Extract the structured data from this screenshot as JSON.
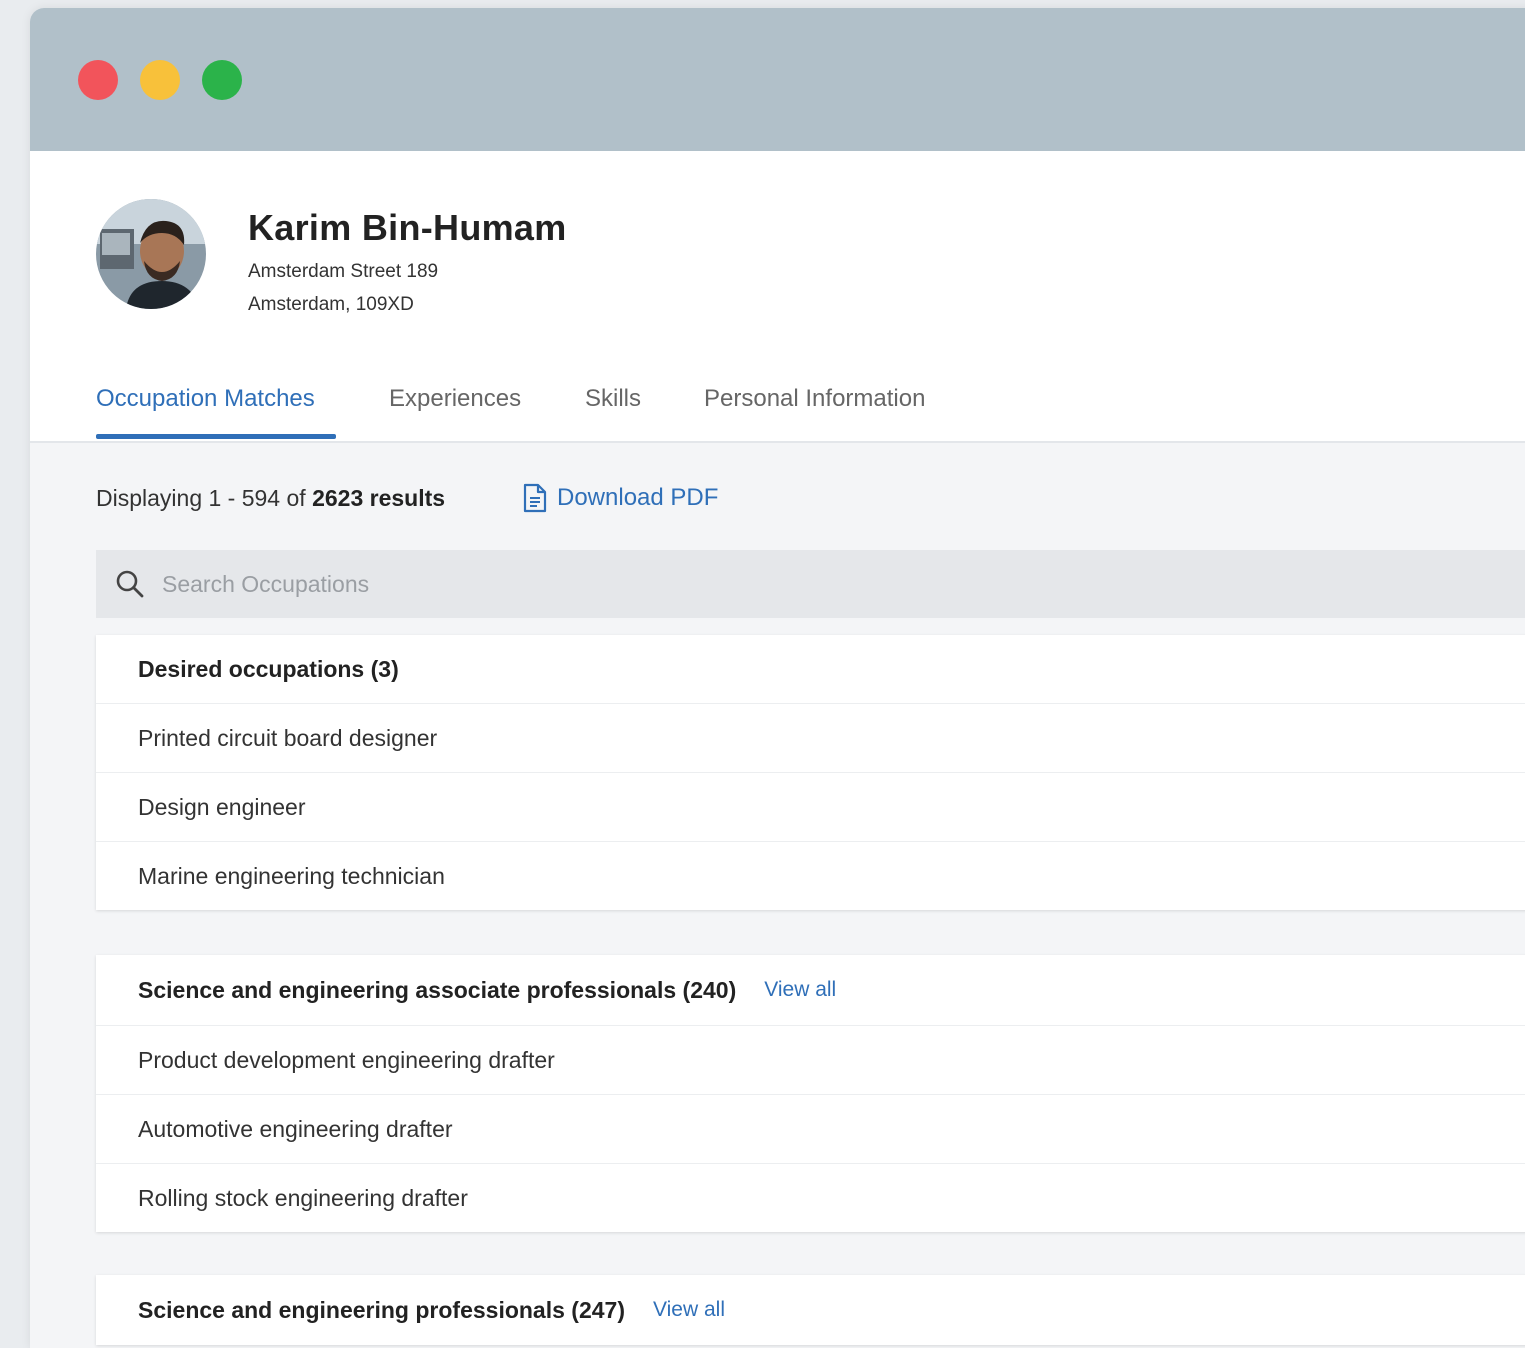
{
  "profile": {
    "name": "Karim Bin-Humam",
    "address_line1": "Amsterdam Street 189",
    "address_line2": "Amsterdam, 109XD"
  },
  "tabs": [
    {
      "label": "Occupation Matches",
      "active": true
    },
    {
      "label": "Experiences",
      "active": false
    },
    {
      "label": "Skills",
      "active": false
    },
    {
      "label": "Personal Information",
      "active": false
    }
  ],
  "results": {
    "prefix": "Displaying 1 - 594 of ",
    "total": "2623 results",
    "download_label": "Download PDF"
  },
  "search": {
    "placeholder": "Search Occupations"
  },
  "groups": [
    {
      "title": "Desired occupations (3)",
      "view_all": "",
      "items": [
        "Printed circuit board designer",
        "Design engineer",
        "Marine engineering technician"
      ]
    },
    {
      "title": "Science and engineering associate professionals (240)",
      "view_all": "View all",
      "items": [
        "Product development engineering drafter",
        "Automotive engineering drafter",
        "Rolling stock engineering drafter"
      ]
    },
    {
      "title": "Science and engineering professionals (247)",
      "view_all": "View all",
      "items": []
    }
  ],
  "colors": {
    "accent": "#2f6fb8",
    "titlebar": "#b1c0c9"
  }
}
